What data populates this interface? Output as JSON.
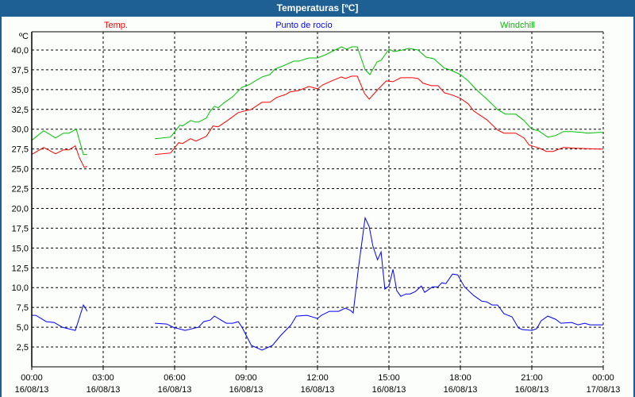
{
  "window": {
    "title": "Temperaturas [ºC]"
  },
  "chart_data": {
    "type": "line",
    "title": "Temperaturas [ºC]",
    "ylabel": "ºC",
    "ylim": [
      0,
      40
    ],
    "xlim_hours": [
      0,
      24
    ],
    "grid": true,
    "y_ticks": [
      "2,5",
      "5,0",
      "7,5",
      "10,0",
      "12,5",
      "15,0",
      "17,5",
      "20,0",
      "22,5",
      "25,0",
      "27,5",
      "30,0",
      "32,5",
      "35,0",
      "37,5",
      "40,0"
    ],
    "x_ticks": [
      {
        "time": "00:00",
        "date": "16/08/13"
      },
      {
        "time": "03:00",
        "date": "16/08/13"
      },
      {
        "time": "06:00",
        "date": "16/08/13"
      },
      {
        "time": "09:00",
        "date": "16/08/13"
      },
      {
        "time": "12:00",
        "date": "16/08/13"
      },
      {
        "time": "15:00",
        "date": "16/08/13"
      },
      {
        "time": "18:00",
        "date": "16/08/13"
      },
      {
        "time": "21:00",
        "date": "16/08/13"
      },
      {
        "time": "00:00",
        "date": "17/08/13"
      }
    ],
    "series": [
      {
        "name": "Temp.",
        "color": "#ff0000",
        "segments": [
          [
            [
              0,
              26.8
            ],
            [
              0.5,
              27.7
            ],
            [
              1.0,
              26.9
            ],
            [
              1.33,
              27.4
            ],
            [
              1.56,
              27.4
            ],
            [
              1.83,
              27.9
            ],
            [
              2.0,
              26.4
            ],
            [
              2.2,
              25.2
            ],
            [
              2.33,
              25.3
            ]
          ],
          [
            [
              5.17,
              26.8
            ],
            [
              5.83,
              27.0
            ],
            [
              6.17,
              28.3
            ],
            [
              6.33,
              28.2
            ],
            [
              6.67,
              28.8
            ],
            [
              6.89,
              28.5
            ],
            [
              7.33,
              29.1
            ],
            [
              7.61,
              30.4
            ],
            [
              7.83,
              30.3
            ],
            [
              8.22,
              31.1
            ],
            [
              8.67,
              32.1
            ],
            [
              8.94,
              32.3
            ],
            [
              9.22,
              32.5
            ],
            [
              9.67,
              33.4
            ],
            [
              10.0,
              33.4
            ],
            [
              10.28,
              34.0
            ],
            [
              10.67,
              34.4
            ],
            [
              10.83,
              34.7
            ],
            [
              11.22,
              34.9
            ],
            [
              11.64,
              35.4
            ],
            [
              12.0,
              35.1
            ],
            [
              12.22,
              35.6
            ],
            [
              12.67,
              36.2
            ],
            [
              13.0,
              36.6
            ],
            [
              13.17,
              36.4
            ],
            [
              13.44,
              36.7
            ],
            [
              13.67,
              36.7
            ],
            [
              13.98,
              34.5
            ],
            [
              14.17,
              33.8
            ],
            [
              14.56,
              35.1
            ],
            [
              14.89,
              36.1
            ],
            [
              15.17,
              36.0
            ],
            [
              15.5,
              36.5
            ],
            [
              16.0,
              36.5
            ],
            [
              16.22,
              36.4
            ],
            [
              16.44,
              35.8
            ],
            [
              16.78,
              35.5
            ],
            [
              17.06,
              35.5
            ],
            [
              17.33,
              34.6
            ],
            [
              17.67,
              34.3
            ],
            [
              18.0,
              33.9
            ],
            [
              18.33,
              33.2
            ],
            [
              18.56,
              32.3
            ],
            [
              19.11,
              31.2
            ],
            [
              19.56,
              29.9
            ],
            [
              19.83,
              29.5
            ],
            [
              20.33,
              29.5
            ],
            [
              20.67,
              28.9
            ],
            [
              20.89,
              28.0
            ],
            [
              21.33,
              27.6
            ],
            [
              21.61,
              27.2
            ],
            [
              21.89,
              27.2
            ],
            [
              22.33,
              27.7
            ],
            [
              22.89,
              27.6
            ],
            [
              23.83,
              27.5
            ],
            [
              24.0,
              27.5
            ]
          ]
        ]
      },
      {
        "name": "Punto de rocío",
        "color": "#0000ff",
        "segments": [
          [
            [
              0,
              6.5
            ],
            [
              0.17,
              6.5
            ],
            [
              0.61,
              5.7
            ],
            [
              0.94,
              5.6
            ],
            [
              1.28,
              5.0
            ],
            [
              1.83,
              4.6
            ],
            [
              2.17,
              7.8
            ],
            [
              2.33,
              7.0
            ]
          ],
          [
            [
              5.17,
              5.5
            ],
            [
              5.67,
              5.4
            ],
            [
              5.94,
              5.0
            ],
            [
              6.44,
              4.6
            ],
            [
              7.0,
              5.0
            ],
            [
              7.22,
              5.7
            ],
            [
              7.5,
              5.9
            ],
            [
              7.67,
              6.4
            ],
            [
              8.17,
              5.5
            ],
            [
              8.44,
              5.5
            ],
            [
              8.67,
              5.7
            ],
            [
              8.83,
              5.0
            ],
            [
              9.22,
              2.7
            ],
            [
              9.67,
              2.1
            ],
            [
              10.11,
              2.7
            ],
            [
              10.44,
              3.9
            ],
            [
              10.89,
              5.3
            ],
            [
              11.11,
              6.4
            ],
            [
              11.56,
              6.5
            ],
            [
              12.0,
              6.1
            ],
            [
              12.17,
              6.5
            ],
            [
              12.5,
              7.0
            ],
            [
              12.89,
              7.0
            ],
            [
              13.17,
              7.4
            ],
            [
              13.39,
              7.1
            ],
            [
              13.5,
              6.8
            ],
            [
              13.72,
              12.5
            ],
            [
              14.0,
              18.8
            ],
            [
              14.17,
              17.7
            ],
            [
              14.33,
              15.2
            ],
            [
              14.52,
              13.5
            ],
            [
              14.67,
              14.5
            ],
            [
              14.83,
              9.8
            ],
            [
              15.0,
              10.2
            ],
            [
              15.17,
              12.3
            ],
            [
              15.33,
              9.6
            ],
            [
              15.5,
              8.9
            ],
            [
              15.72,
              9.2
            ],
            [
              15.89,
              9.2
            ],
            [
              16.11,
              9.5
            ],
            [
              16.36,
              10.2
            ],
            [
              16.5,
              9.4
            ],
            [
              16.83,
              10.1
            ],
            [
              17.06,
              10.1
            ],
            [
              17.22,
              10.6
            ],
            [
              17.39,
              10.5
            ],
            [
              17.67,
              11.7
            ],
            [
              17.89,
              11.6
            ],
            [
              18.17,
              10.1
            ],
            [
              18.56,
              9.0
            ],
            [
              18.89,
              8.3
            ],
            [
              19.11,
              8.2
            ],
            [
              19.33,
              7.8
            ],
            [
              19.56,
              7.8
            ],
            [
              19.83,
              6.7
            ],
            [
              20.17,
              6.3
            ],
            [
              20.44,
              4.9
            ],
            [
              20.61,
              4.7
            ],
            [
              21.0,
              4.6
            ],
            [
              21.2,
              4.8
            ],
            [
              21.39,
              5.8
            ],
            [
              21.67,
              6.4
            ],
            [
              22.0,
              6.0
            ],
            [
              22.22,
              5.5
            ],
            [
              22.67,
              5.6
            ],
            [
              22.94,
              5.3
            ],
            [
              23.22,
              5.5
            ],
            [
              23.44,
              5.3
            ],
            [
              23.83,
              5.3
            ],
            [
              24.0,
              5.3
            ]
          ]
        ]
      },
      {
        "name": "Windchill",
        "color": "#00c000",
        "segments": [
          [
            [
              0,
              28.6
            ],
            [
              0.5,
              29.8
            ],
            [
              1.0,
              28.9
            ],
            [
              1.33,
              29.5
            ],
            [
              1.56,
              29.5
            ],
            [
              1.87,
              30.0
            ],
            [
              2.17,
              26.8
            ],
            [
              2.33,
              26.8
            ]
          ],
          [
            [
              5.17,
              28.8
            ],
            [
              5.83,
              29.0
            ],
            [
              6.22,
              30.5
            ],
            [
              6.33,
              30.4
            ],
            [
              6.67,
              31.1
            ],
            [
              6.89,
              30.9
            ],
            [
              7.0,
              30.9
            ],
            [
              7.33,
              31.4
            ],
            [
              7.5,
              32.3
            ],
            [
              7.67,
              32.9
            ],
            [
              7.83,
              32.7
            ],
            [
              8.06,
              33.3
            ],
            [
              8.44,
              34.1
            ],
            [
              8.83,
              35.3
            ],
            [
              9.11,
              35.6
            ],
            [
              9.67,
              36.6
            ],
            [
              10.0,
              36.9
            ],
            [
              10.22,
              37.6
            ],
            [
              10.56,
              38.0
            ],
            [
              11.0,
              38.6
            ],
            [
              11.22,
              38.6
            ],
            [
              11.64,
              39.0
            ],
            [
              12.0,
              39.0
            ],
            [
              12.33,
              39.4
            ],
            [
              13.0,
              40.4
            ],
            [
              13.22,
              40.1
            ],
            [
              13.44,
              40.4
            ],
            [
              13.67,
              40.4
            ],
            [
              14.0,
              37.5
            ],
            [
              14.2,
              36.9
            ],
            [
              14.5,
              38.5
            ],
            [
              14.67,
              38.7
            ],
            [
              15.0,
              40.1
            ],
            [
              15.22,
              39.8
            ],
            [
              15.56,
              40.0
            ],
            [
              15.83,
              40.2
            ],
            [
              16.22,
              40.0
            ],
            [
              16.56,
              39.1
            ],
            [
              16.89,
              38.9
            ],
            [
              17.33,
              37.7
            ],
            [
              17.56,
              37.5
            ],
            [
              18.0,
              36.9
            ],
            [
              18.33,
              36.1
            ],
            [
              18.67,
              35.0
            ],
            [
              19.11,
              33.8
            ],
            [
              19.56,
              32.5
            ],
            [
              19.89,
              31.9
            ],
            [
              20.33,
              31.9
            ],
            [
              20.67,
              31.1
            ],
            [
              21.0,
              30.0
            ],
            [
              21.28,
              29.8
            ],
            [
              21.67,
              29.0
            ],
            [
              22.0,
              29.2
            ],
            [
              22.33,
              29.7
            ],
            [
              22.67,
              29.7
            ],
            [
              23.11,
              29.6
            ],
            [
              23.33,
              29.5
            ],
            [
              23.83,
              29.6
            ],
            [
              24.0,
              29.6
            ]
          ]
        ]
      }
    ]
  }
}
